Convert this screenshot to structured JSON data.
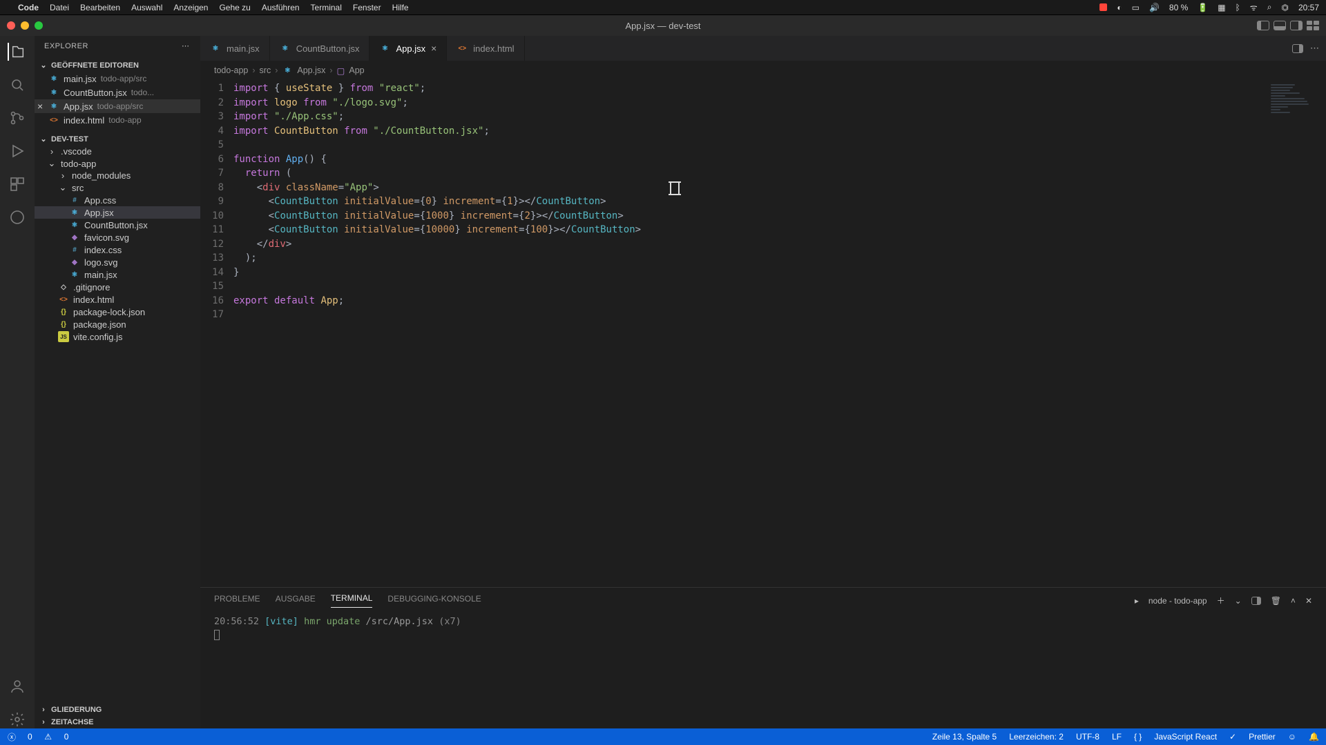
{
  "mac": {
    "app": "Code",
    "menus": [
      "Datei",
      "Bearbeiten",
      "Auswahl",
      "Anzeigen",
      "Gehe zu",
      "Ausführen",
      "Terminal",
      "Fenster",
      "Hilfe"
    ],
    "battery": "80 %",
    "clock": "20:57"
  },
  "window": {
    "title": "App.jsx — dev-test"
  },
  "sidebar": {
    "title": "EXPLORER",
    "section_open": "GEÖFFNETE EDITOREN",
    "open_editors": [
      {
        "name": "main.jsx",
        "path": "todo-app/src",
        "kind": "react"
      },
      {
        "name": "CountButton.jsx",
        "path": "todo...",
        "kind": "react"
      },
      {
        "name": "App.jsx",
        "path": "todo-app/src",
        "kind": "react",
        "active": true
      },
      {
        "name": "index.html",
        "path": "todo-app",
        "kind": "html"
      }
    ],
    "project": "DEV-TEST",
    "tree": [
      {
        "d": 1,
        "type": "folder",
        "open": false,
        "name": ".vscode"
      },
      {
        "d": 1,
        "type": "folder",
        "open": true,
        "name": "todo-app"
      },
      {
        "d": 2,
        "type": "folder",
        "open": false,
        "name": "node_modules"
      },
      {
        "d": 2,
        "type": "folder",
        "open": true,
        "name": "src"
      },
      {
        "d": 3,
        "type": "file",
        "kind": "css",
        "name": "App.css"
      },
      {
        "d": 3,
        "type": "file",
        "kind": "react",
        "name": "App.jsx",
        "sel": true
      },
      {
        "d": 3,
        "type": "file",
        "kind": "react",
        "name": "CountButton.jsx"
      },
      {
        "d": 3,
        "type": "file",
        "kind": "svg",
        "name": "favicon.svg"
      },
      {
        "d": 3,
        "type": "file",
        "kind": "css",
        "name": "index.css"
      },
      {
        "d": 3,
        "type": "file",
        "kind": "svg",
        "name": "logo.svg"
      },
      {
        "d": 3,
        "type": "file",
        "kind": "react",
        "name": "main.jsx"
      },
      {
        "d": 2,
        "type": "file",
        "kind": "git",
        "name": ".gitignore"
      },
      {
        "d": 2,
        "type": "file",
        "kind": "html",
        "name": "index.html"
      },
      {
        "d": 2,
        "type": "file",
        "kind": "json",
        "name": "package-lock.json"
      },
      {
        "d": 2,
        "type": "file",
        "kind": "json",
        "name": "package.json"
      },
      {
        "d": 2,
        "type": "file",
        "kind": "js",
        "name": "vite.config.js"
      }
    ],
    "outline": "GLIEDERUNG",
    "timeline": "ZEITACHSE"
  },
  "tabs": [
    {
      "name": "main.jsx",
      "kind": "react"
    },
    {
      "name": "CountButton.jsx",
      "kind": "react"
    },
    {
      "name": "App.jsx",
      "kind": "react",
      "active": true
    },
    {
      "name": "index.html",
      "kind": "html"
    }
  ],
  "crumbs": [
    "todo-app",
    "src",
    "App.jsx",
    "App"
  ],
  "code": {
    "lines": 17,
    "l1": {
      "a": "import",
      "b": " { ",
      "c": "useState",
      "d": " } ",
      "e": "from",
      "f": " \"react\"",
      "g": ";"
    },
    "l2": {
      "a": "import",
      "b": " logo ",
      "c": "from",
      "d": " \"./logo.svg\"",
      "e": ";"
    },
    "l3": {
      "a": "import",
      "b": " \"./App.css\"",
      "c": ";"
    },
    "l4": {
      "a": "import",
      "b": " CountButton ",
      "c": "from",
      "d": " \"./CountButton.jsx\"",
      "e": ";"
    },
    "l6": {
      "a": "function",
      "b": " App",
      "c": "() {"
    },
    "l7": {
      "a": "  return",
      "b": " ("
    },
    "l8": {
      "a": "    <",
      "b": "div ",
      "c": "className",
      "d": "=",
      "e": "\"App\"",
      "f": ">"
    },
    "l9": {
      "a": "      <",
      "b": "CountButton ",
      "c": "initialValue",
      "d": "={",
      "e": "0",
      "f": "} ",
      "g": "increment",
      "h": "={",
      "i": "1",
      "j": "}></",
      "k": "CountButton",
      "l": ">"
    },
    "l10": {
      "a": "      <",
      "b": "CountButton ",
      "c": "initialValue",
      "d": "={",
      "e": "1000",
      "f": "} ",
      "g": "increment",
      "h": "={",
      "i": "2",
      "j": "}></",
      "k": "CountButton",
      "l": ">"
    },
    "l11": {
      "a": "      <",
      "b": "CountButton ",
      "c": "initialValue",
      "d": "={",
      "e": "10000",
      "f": "} ",
      "g": "increment",
      "h": "={",
      "i": "100",
      "j": "}></",
      "k": "CountButton",
      "l": ">"
    },
    "l12": {
      "a": "    </",
      "b": "div",
      "c": ">"
    },
    "l13": {
      "a": "  );"
    },
    "l14": {
      "a": "}"
    },
    "l16": {
      "a": "export default",
      "b": " App",
      "c": ";"
    }
  },
  "panel": {
    "tabs": [
      "PROBLEME",
      "AUSGABE",
      "TERMINAL",
      "DEBUGGING-KONSOLE"
    ],
    "active": 2,
    "task": "node - todo-app",
    "line": {
      "time": "20:56:52",
      "tag": "[vite]",
      "msg": "hmr update",
      "path": "/src/App.jsx",
      "mult": "(x7)"
    }
  },
  "status": {
    "errors": "0",
    "warnings": "0",
    "pos": "Zeile 13, Spalte 5",
    "indent": "Leerzeichen: 2",
    "enc": "UTF-8",
    "eol": "LF",
    "lang": "JavaScript React",
    "prettier": "Prettier"
  }
}
